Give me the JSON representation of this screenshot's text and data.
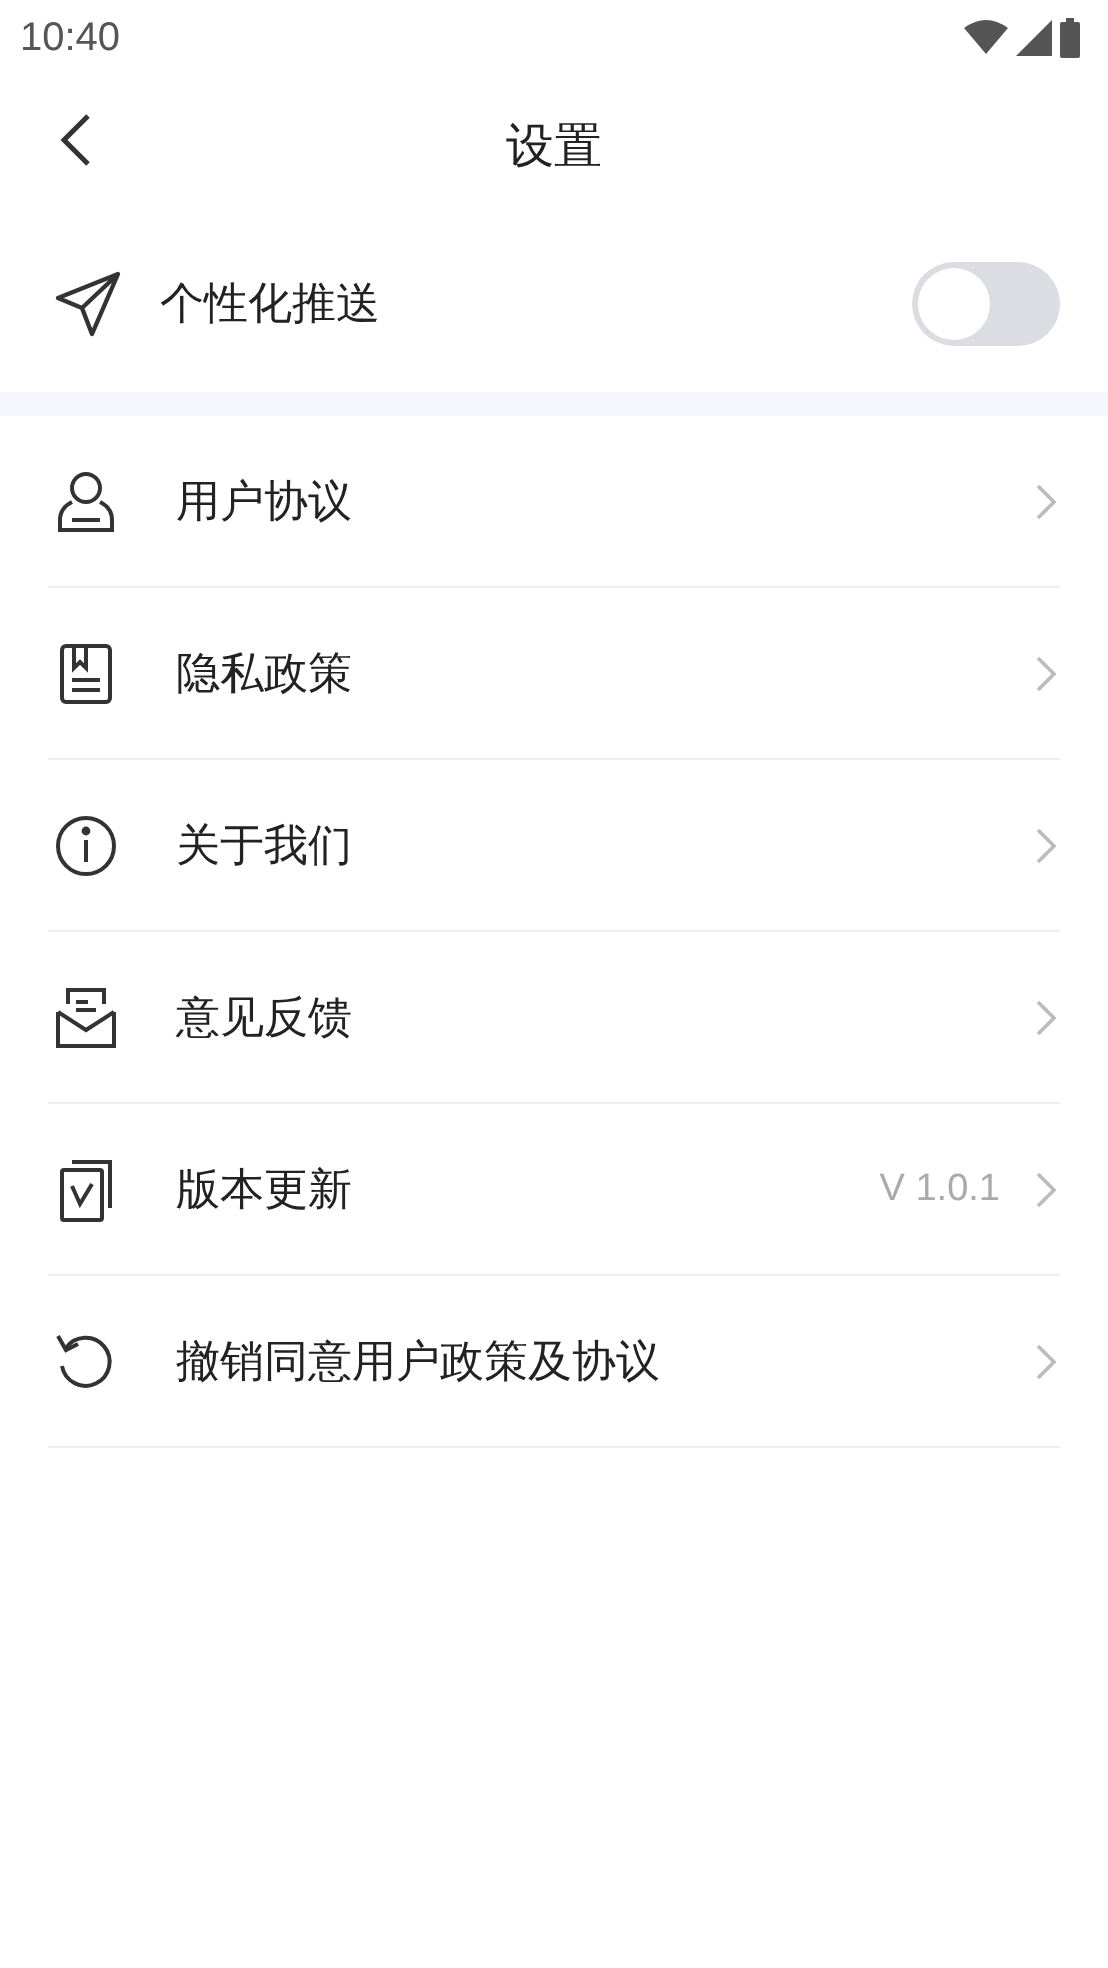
{
  "status_bar": {
    "time": "10:40"
  },
  "header": {
    "title": "设置"
  },
  "push": {
    "label": "个性化推送",
    "on": false
  },
  "items": [
    {
      "kind": "user",
      "label": "用户协议"
    },
    {
      "kind": "doc",
      "label": "隐私政策"
    },
    {
      "kind": "info",
      "label": "关于我们"
    },
    {
      "kind": "mail",
      "label": "意见反馈"
    },
    {
      "kind": "version",
      "label": "版本更新",
      "value": "V 1.0.1"
    },
    {
      "kind": "revoke",
      "label": "撤销同意用户政策及协议"
    }
  ]
}
